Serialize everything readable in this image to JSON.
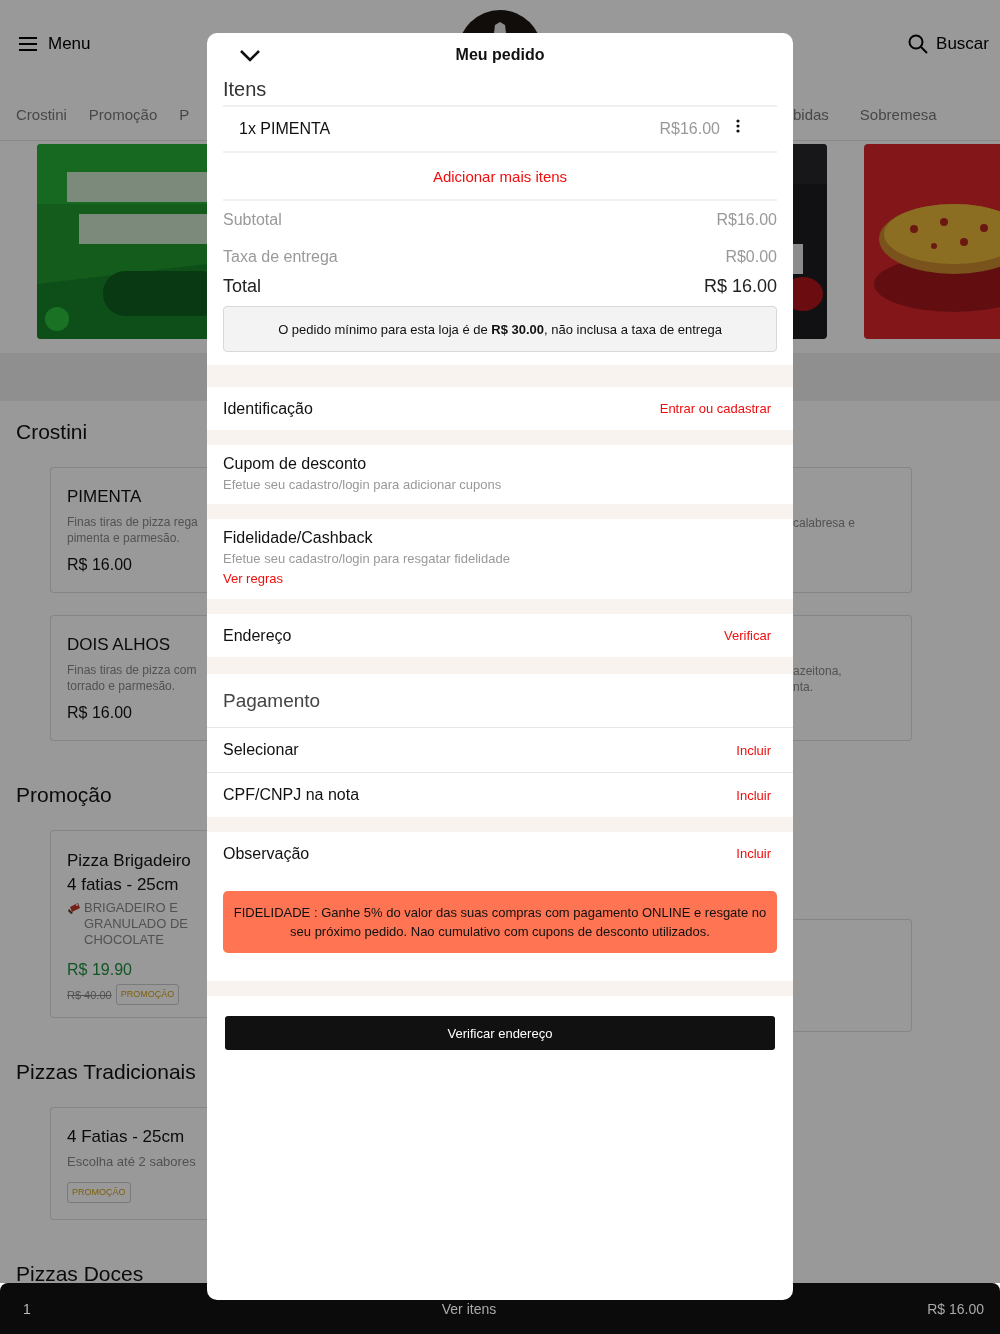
{
  "page": {
    "menu_label": "Menu",
    "search_label": "Buscar",
    "tabs_left": [
      {
        "label": "Crostini",
        "selected": false
      },
      {
        "label": "Promoção",
        "selected": false
      },
      {
        "label": "P",
        "selected": false
      }
    ],
    "tabs_right": [
      {
        "label": "bidas",
        "selected": false
      },
      {
        "label": "Sobremesa",
        "selected": false
      }
    ],
    "sections": [
      {
        "title": "Crostini",
        "cards": [
          {
            "kind": "product",
            "name": "PIMENTA",
            "description": [
              "Finas tiras de pizza rega",
              "pimenta e parmesão."
            ],
            "price": "R$ 16.00"
          },
          {
            "kind": "product",
            "name": "DOIS ALHOS",
            "description": [
              "Finas tiras de pizza com",
              "torrado e parmesão."
            ],
            "price": "R$ 16.00"
          }
        ],
        "right_cards": [
          {
            "kind": "text",
            "description": [
              "calabresa e"
            ]
          },
          {
            "kind": "text",
            "description": [
              "azeitona,",
              "nta."
            ]
          }
        ]
      },
      {
        "title": "Promoção",
        "cards": [
          {
            "kind": "promo",
            "name": "Pizza Brigadeiro 4 fatias - 25cm",
            "description": "BRIGADEIRO E GRANULADO DE CHOCOLATE",
            "price": "R$ 19.90",
            "old_price": "R$ 40.00",
            "badge": "PROMOÇÃO"
          }
        ]
      },
      {
        "title": "Pizzas Tradicionais",
        "cards": [
          {
            "kind": "choice",
            "name": "4 Fatias - 25cm",
            "description": "Escolha até 2 sabores",
            "badge": "PROMOÇÃO"
          }
        ],
        "right_cards": [
          {
            "kind": "empty"
          }
        ]
      },
      {
        "title": "Pizzas Doces"
      }
    ]
  },
  "bottom_bar": {
    "count": "1",
    "label": "Ver itens",
    "total": "R$ 16.00"
  },
  "order": {
    "title": "Meu pedido",
    "items_heading": "Itens",
    "items": [
      {
        "name": "1x PIMENTA",
        "price": "R$16.00"
      }
    ],
    "add_more": "Adicionar mais itens",
    "summary": [
      {
        "kind": "minor",
        "label": "Subtotal",
        "value": "R$16.00"
      },
      {
        "kind": "minor",
        "label": "Taxa de entrega",
        "value": "R$0.00"
      },
      {
        "kind": "total",
        "label": "Total",
        "value": "R$ 16.00"
      }
    ],
    "notice": "O pedido mínimo para esta loja é de **R$ 30.00**, não inclusa a taxa de entrega",
    "sections": [
      {
        "kind": "row",
        "label": "Identificação",
        "action": "Entrar ou cadastrar"
      },
      {
        "kind": "info",
        "label": "Cupom de desconto",
        "hint": "Efetue seu cadastro/login para adicionar cupons"
      },
      {
        "kind": "info",
        "label": "Fidelidade/Cashback",
        "hint": "Efetue seu cadastro/login para resgatar fidelidade",
        "link": "Ver regras"
      },
      {
        "kind": "row",
        "label": "Endereço",
        "action": "Verificar"
      },
      {
        "kind": "group",
        "heading": "Pagamento",
        "rows": [
          {
            "label": "Selecionar",
            "action": "Incluir"
          },
          {
            "label": "CPF/CNPJ na nota",
            "action": "Incluir"
          }
        ]
      },
      {
        "kind": "note",
        "label": "Observação",
        "action": "Incluir",
        "banner": "FIDELIDADE : Ganhe 5% do valor das suas compras com pagamento ONLINE e resgate no seu próximo pedido. Nao cumulativo com cupons de desconto utilizados."
      }
    ],
    "submit": "Verificar endereço"
  }
}
